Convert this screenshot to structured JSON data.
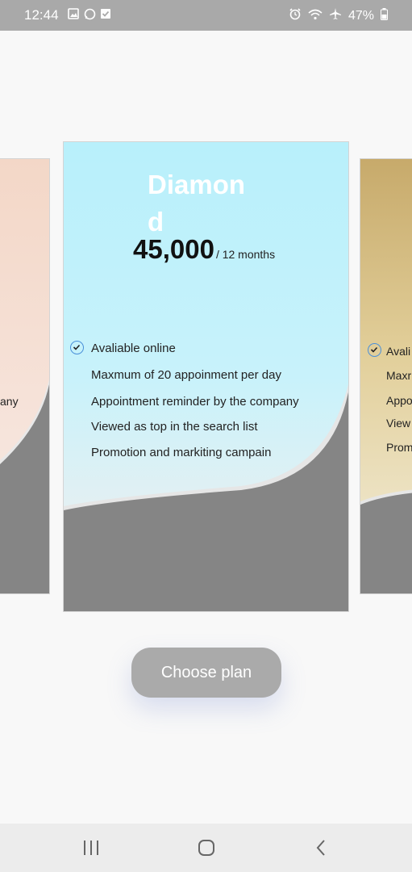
{
  "status_bar": {
    "time": "12:44",
    "left_icons": [
      "image-icon",
      "whatsapp-icon",
      "checkbox-icon"
    ],
    "right_icons": [
      "alarm-icon",
      "wifi-icon",
      "airplane-icon",
      "battery-icon"
    ],
    "battery": "47%"
  },
  "left_card": {
    "feature_partial": "any"
  },
  "center_card": {
    "plan_name": "Diamond",
    "price": "45,000",
    "period": "/ 12 months",
    "features": [
      "Avaliable online",
      "Maxmum of 20 appoinment per day",
      "Appointment reminder by the company",
      "Viewed as top in the search list",
      "Promotion and markiting campain"
    ]
  },
  "right_card": {
    "features_partial": [
      "Avali",
      "Maxr",
      "Appo",
      "View",
      "Prom"
    ]
  },
  "choose_button": {
    "label": "Choose plan"
  },
  "colors": {
    "status_bar": "#a9a9a9",
    "center_card_top": "#b8f0fb",
    "wave_fill": "#858585",
    "button": "#aaaaaa",
    "check": "#4a90d9"
  }
}
